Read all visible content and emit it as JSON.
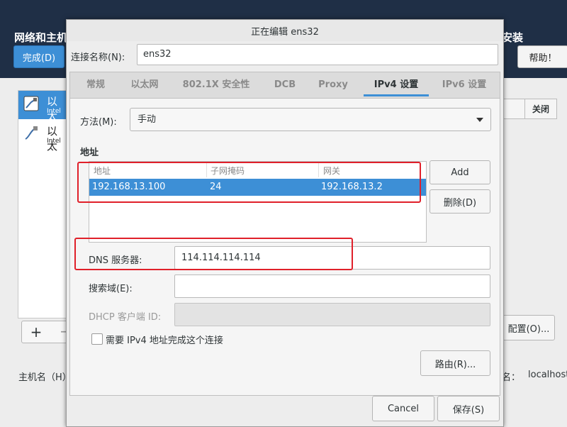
{
  "background": {
    "title": "网络和主机",
    "title_right": "安装",
    "done_button": "完成(D)",
    "help_button": "帮助！",
    "devices": [
      {
        "name": "以太",
        "sub": "Intel"
      },
      {
        "name": "以太",
        "sub": "Intel"
      }
    ],
    "add_label": "+",
    "remove_label": "−",
    "close_label": "关闭",
    "config_button": "配置(O)...",
    "hostname_label": "主机名（H）",
    "hostname_right_label": "名：",
    "hostname_value": "localhost"
  },
  "dialog": {
    "title": "正在编辑 ens32",
    "connection_name_label": "连接名称(N):",
    "connection_name_value": "ens32",
    "tabs": [
      "常规",
      "以太网",
      "802.1X 安全性",
      "DCB",
      "Proxy",
      "IPv4 设置",
      "IPv6 设置"
    ],
    "active_tab": "IPv4 设置",
    "method_label": "方法(M):",
    "method_value": "手动",
    "address_heading": "地址",
    "address_columns": [
      "地址",
      "子网掩码",
      "网关"
    ],
    "address_rows": [
      {
        "address": "192.168.13.100",
        "netmask": "24",
        "gateway": "192.168.13.2"
      }
    ],
    "add_button": "Add",
    "delete_button": "删除(D)",
    "dns_label": "DNS 服务器:",
    "dns_value": "114.114.114.114",
    "search_domain_label": "搜索域(E):",
    "search_domain_value": "",
    "dhcp_client_id_label": "DHCP 客户端 ID:",
    "dhcp_client_id_value": "",
    "require_ipv4_label": "需要 IPv4 地址完成这个连接",
    "require_ipv4_checked": false,
    "routes_button": "路由(R)...",
    "cancel_button": "Cancel",
    "save_button": "保存(S)"
  },
  "colors": {
    "header_bg": "#1f2f46",
    "accent": "#3d8fd6",
    "annotation_red": "#e0202a"
  }
}
